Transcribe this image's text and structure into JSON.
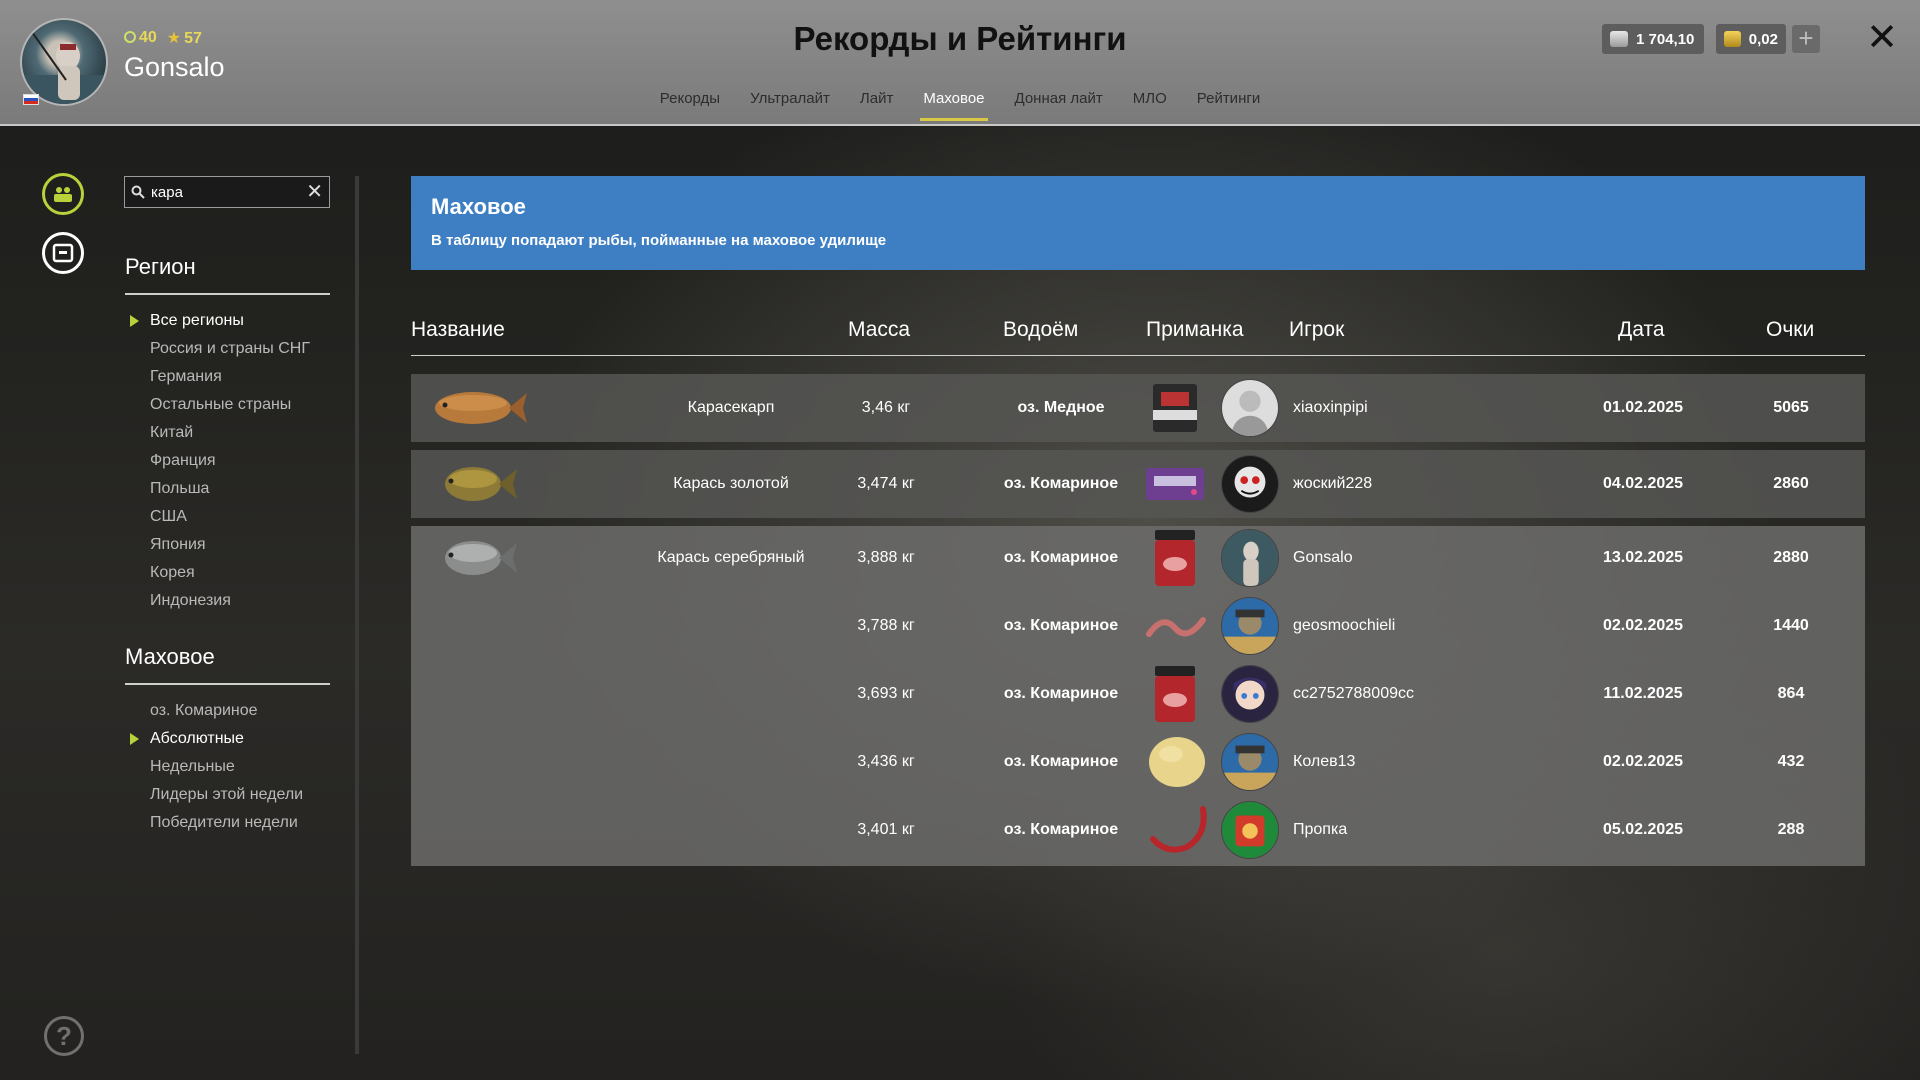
{
  "player": {
    "level": "40",
    "rank": "57",
    "name": "Gonsalo"
  },
  "header": {
    "title": "Рекорды и Рейтинги",
    "tabs": [
      {
        "label": "Рекорды"
      },
      {
        "label": "Ультралайт"
      },
      {
        "label": "Лайт"
      },
      {
        "label": "Маховое",
        "active": true
      },
      {
        "label": "Донная лайт"
      },
      {
        "label": "МЛО"
      },
      {
        "label": "Рейтинги"
      }
    ],
    "silver": "1 704,10",
    "gold": "0,02"
  },
  "search": {
    "value": "кара",
    "placeholder": ""
  },
  "region": {
    "title": "Регион",
    "items": [
      {
        "label": "Все регионы",
        "active": true
      },
      {
        "label": "Россия и страны СНГ"
      },
      {
        "label": "Германия"
      },
      {
        "label": "Остальные страны"
      },
      {
        "label": "Китай"
      },
      {
        "label": "Франция"
      },
      {
        "label": "Польша"
      },
      {
        "label": "США"
      },
      {
        "label": "Япония"
      },
      {
        "label": "Корея"
      },
      {
        "label": "Индонезия"
      }
    ]
  },
  "category": {
    "title": "Маховое",
    "items": [
      {
        "label": "оз. Комариное"
      },
      {
        "label": "Абсолютные",
        "active": true
      },
      {
        "label": "Недельные"
      },
      {
        "label": "Лидеры этой недели"
      },
      {
        "label": "Победители недели"
      }
    ]
  },
  "banner": {
    "title": "Маховое",
    "subtitle": "В таблицу попадают рыбы, пойманные на маховое удилище"
  },
  "table": {
    "headers": {
      "name": "Название",
      "mass": "Масса",
      "water": "Водоём",
      "bait": "Приманка",
      "player": "Игрок",
      "date": "Дата",
      "points": "Очки"
    },
    "rows": [
      {
        "fish": "Карасекарп",
        "mass": "3,46 кг",
        "water": "оз. Медное",
        "bait": "groundbait-pack",
        "player": "xiaoxinpipi",
        "date": "01.02.2025",
        "points": "5065"
      },
      {
        "fish": "Карась золотой",
        "mass": "3,474 кг",
        "water": "оз. Комариное",
        "bait": "purple-box",
        "player": "жоский228",
        "date": "04.02.2025",
        "points": "2860"
      },
      {
        "fish": "Карась серебряный",
        "entries": [
          {
            "mass": "3,888 кг",
            "water": "оз. Комариное",
            "bait": "red-jar",
            "player": "Gonsalo",
            "date": "13.02.2025",
            "points": "2880"
          },
          {
            "mass": "3,788 кг",
            "water": "оз. Комариное",
            "bait": "worm",
            "player": "geosmoochieli",
            "date": "02.02.2025",
            "points": "1440"
          },
          {
            "mass": "3,693 кг",
            "water": "оз. Комариное",
            "bait": "red-jar",
            "player": "cc2752788009cc",
            "date": "11.02.2025",
            "points": "864"
          },
          {
            "mass": "3,436 кг",
            "water": "оз. Комариное",
            "bait": "dough-ball",
            "player": "Колев13",
            "date": "02.02.2025",
            "points": "432"
          },
          {
            "mass": "3,401 кг",
            "water": "оз. Комариное",
            "bait": "red-worm",
            "player": "Пропка",
            "date": "05.02.2025",
            "points": "288"
          }
        ]
      }
    ]
  },
  "colors": {
    "accent": "#b7d23a",
    "banner": "#3e7fc4",
    "header": "#888888"
  }
}
